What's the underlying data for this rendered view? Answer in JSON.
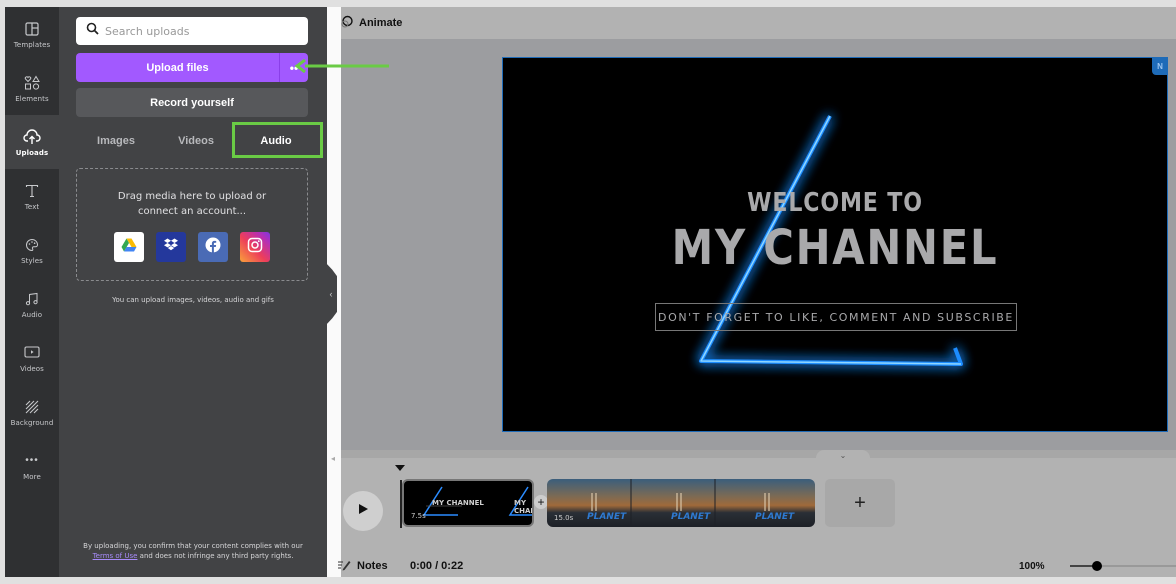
{
  "rail": {
    "items": [
      {
        "label": "Templates",
        "icon": "templates-icon"
      },
      {
        "label": "Elements",
        "icon": "elements-icon"
      },
      {
        "label": "Uploads",
        "icon": "upload-cloud-icon",
        "active": true
      },
      {
        "label": "Text",
        "icon": "text-icon"
      },
      {
        "label": "Styles",
        "icon": "palette-icon"
      },
      {
        "label": "Audio",
        "icon": "music-note-icon"
      },
      {
        "label": "Videos",
        "icon": "video-icon"
      },
      {
        "label": "Background",
        "icon": "background-hatch-icon"
      },
      {
        "label": "More",
        "icon": "more-dots-icon"
      }
    ]
  },
  "panel": {
    "search_placeholder": "Search uploads",
    "upload_label": "Upload files",
    "upload_more": "••",
    "record_label": "Record yourself",
    "tabs": [
      {
        "label": "Images"
      },
      {
        "label": "Videos"
      },
      {
        "label": "Audio",
        "active": true
      }
    ],
    "dropzone_line1": "Drag media here to upload or",
    "dropzone_line2": "connect an account...",
    "services": [
      "Google Drive",
      "Dropbox",
      "Facebook",
      "Instagram"
    ],
    "hint": "You can upload images, videos, audio and gifs",
    "legal_before": "By uploading, you confirm that your content complies with our ",
    "legal_link": "Terms of Use",
    "legal_after": " and does not infringe any third party rights."
  },
  "annotation": {
    "highlight_color": "#6acb45"
  },
  "editor": {
    "animate_label": "Animate",
    "canvas": {
      "welcome": "WELCOME TO",
      "title": "MY CHANNEL",
      "subtitle": "DON'T FORGET TO LIKE, COMMENT AND SUBSCRIBE",
      "badge": "N"
    },
    "timeline": {
      "clips": [
        {
          "duration": "7.5s",
          "thumb_title": "MY CHANNEL"
        },
        {
          "duration": "15.0s",
          "thumb_title": "PLANET"
        }
      ],
      "add_label": "+"
    },
    "bottom": {
      "notes_label": "Notes",
      "time": "0:00 / 0:22",
      "zoom": "100%",
      "zoom_fraction": 0.25
    }
  },
  "colors": {
    "accent": "#a259ff",
    "rail_bg": "#2f3032",
    "panel_bg": "#424345",
    "selection": "#1e6bb8"
  }
}
